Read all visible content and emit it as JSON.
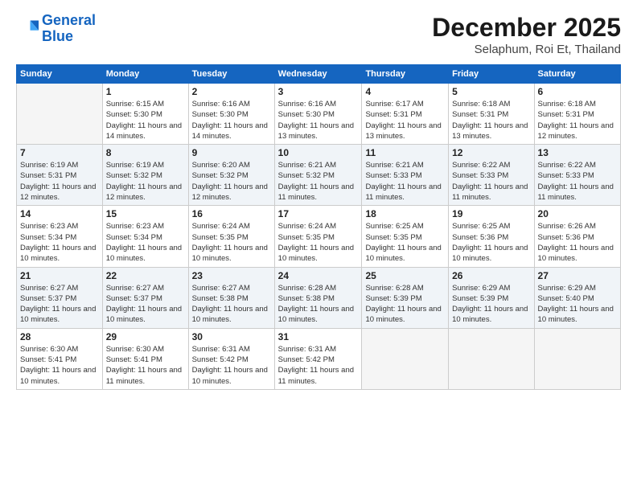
{
  "logo": {
    "line1": "General",
    "line2": "Blue"
  },
  "title": "December 2025",
  "subtitle": "Selaphum, Roi Et, Thailand",
  "weekdays": [
    "Sunday",
    "Monday",
    "Tuesday",
    "Wednesday",
    "Thursday",
    "Friday",
    "Saturday"
  ],
  "weeks": [
    [
      {
        "day": "",
        "info": ""
      },
      {
        "day": "1",
        "info": "Sunrise: 6:15 AM\nSunset: 5:30 PM\nDaylight: 11 hours\nand 14 minutes."
      },
      {
        "day": "2",
        "info": "Sunrise: 6:16 AM\nSunset: 5:30 PM\nDaylight: 11 hours\nand 14 minutes."
      },
      {
        "day": "3",
        "info": "Sunrise: 6:16 AM\nSunset: 5:30 PM\nDaylight: 11 hours\nand 13 minutes."
      },
      {
        "day": "4",
        "info": "Sunrise: 6:17 AM\nSunset: 5:31 PM\nDaylight: 11 hours\nand 13 minutes."
      },
      {
        "day": "5",
        "info": "Sunrise: 6:18 AM\nSunset: 5:31 PM\nDaylight: 11 hours\nand 13 minutes."
      },
      {
        "day": "6",
        "info": "Sunrise: 6:18 AM\nSunset: 5:31 PM\nDaylight: 11 hours\nand 12 minutes."
      }
    ],
    [
      {
        "day": "7",
        "info": "Sunrise: 6:19 AM\nSunset: 5:31 PM\nDaylight: 11 hours\nand 12 minutes."
      },
      {
        "day": "8",
        "info": "Sunrise: 6:19 AM\nSunset: 5:32 PM\nDaylight: 11 hours\nand 12 minutes."
      },
      {
        "day": "9",
        "info": "Sunrise: 6:20 AM\nSunset: 5:32 PM\nDaylight: 11 hours\nand 12 minutes."
      },
      {
        "day": "10",
        "info": "Sunrise: 6:21 AM\nSunset: 5:32 PM\nDaylight: 11 hours\nand 11 minutes."
      },
      {
        "day": "11",
        "info": "Sunrise: 6:21 AM\nSunset: 5:33 PM\nDaylight: 11 hours\nand 11 minutes."
      },
      {
        "day": "12",
        "info": "Sunrise: 6:22 AM\nSunset: 5:33 PM\nDaylight: 11 hours\nand 11 minutes."
      },
      {
        "day": "13",
        "info": "Sunrise: 6:22 AM\nSunset: 5:33 PM\nDaylight: 11 hours\nand 11 minutes."
      }
    ],
    [
      {
        "day": "14",
        "info": "Sunrise: 6:23 AM\nSunset: 5:34 PM\nDaylight: 11 hours\nand 10 minutes."
      },
      {
        "day": "15",
        "info": "Sunrise: 6:23 AM\nSunset: 5:34 PM\nDaylight: 11 hours\nand 10 minutes."
      },
      {
        "day": "16",
        "info": "Sunrise: 6:24 AM\nSunset: 5:35 PM\nDaylight: 11 hours\nand 10 minutes."
      },
      {
        "day": "17",
        "info": "Sunrise: 6:24 AM\nSunset: 5:35 PM\nDaylight: 11 hours\nand 10 minutes."
      },
      {
        "day": "18",
        "info": "Sunrise: 6:25 AM\nSunset: 5:35 PM\nDaylight: 11 hours\nand 10 minutes."
      },
      {
        "day": "19",
        "info": "Sunrise: 6:25 AM\nSunset: 5:36 PM\nDaylight: 11 hours\nand 10 minutes."
      },
      {
        "day": "20",
        "info": "Sunrise: 6:26 AM\nSunset: 5:36 PM\nDaylight: 11 hours\nand 10 minutes."
      }
    ],
    [
      {
        "day": "21",
        "info": "Sunrise: 6:27 AM\nSunset: 5:37 PM\nDaylight: 11 hours\nand 10 minutes."
      },
      {
        "day": "22",
        "info": "Sunrise: 6:27 AM\nSunset: 5:37 PM\nDaylight: 11 hours\nand 10 minutes."
      },
      {
        "day": "23",
        "info": "Sunrise: 6:27 AM\nSunset: 5:38 PM\nDaylight: 11 hours\nand 10 minutes."
      },
      {
        "day": "24",
        "info": "Sunrise: 6:28 AM\nSunset: 5:38 PM\nDaylight: 11 hours\nand 10 minutes."
      },
      {
        "day": "25",
        "info": "Sunrise: 6:28 AM\nSunset: 5:39 PM\nDaylight: 11 hours\nand 10 minutes."
      },
      {
        "day": "26",
        "info": "Sunrise: 6:29 AM\nSunset: 5:39 PM\nDaylight: 11 hours\nand 10 minutes."
      },
      {
        "day": "27",
        "info": "Sunrise: 6:29 AM\nSunset: 5:40 PM\nDaylight: 11 hours\nand 10 minutes."
      }
    ],
    [
      {
        "day": "28",
        "info": "Sunrise: 6:30 AM\nSunset: 5:41 PM\nDaylight: 11 hours\nand 10 minutes."
      },
      {
        "day": "29",
        "info": "Sunrise: 6:30 AM\nSunset: 5:41 PM\nDaylight: 11 hours\nand 11 minutes."
      },
      {
        "day": "30",
        "info": "Sunrise: 6:31 AM\nSunset: 5:42 PM\nDaylight: 11 hours\nand 10 minutes."
      },
      {
        "day": "31",
        "info": "Sunrise: 6:31 AM\nSunset: 5:42 PM\nDaylight: 11 hours\nand 11 minutes."
      },
      {
        "day": "",
        "info": ""
      },
      {
        "day": "",
        "info": ""
      },
      {
        "day": "",
        "info": ""
      }
    ]
  ]
}
